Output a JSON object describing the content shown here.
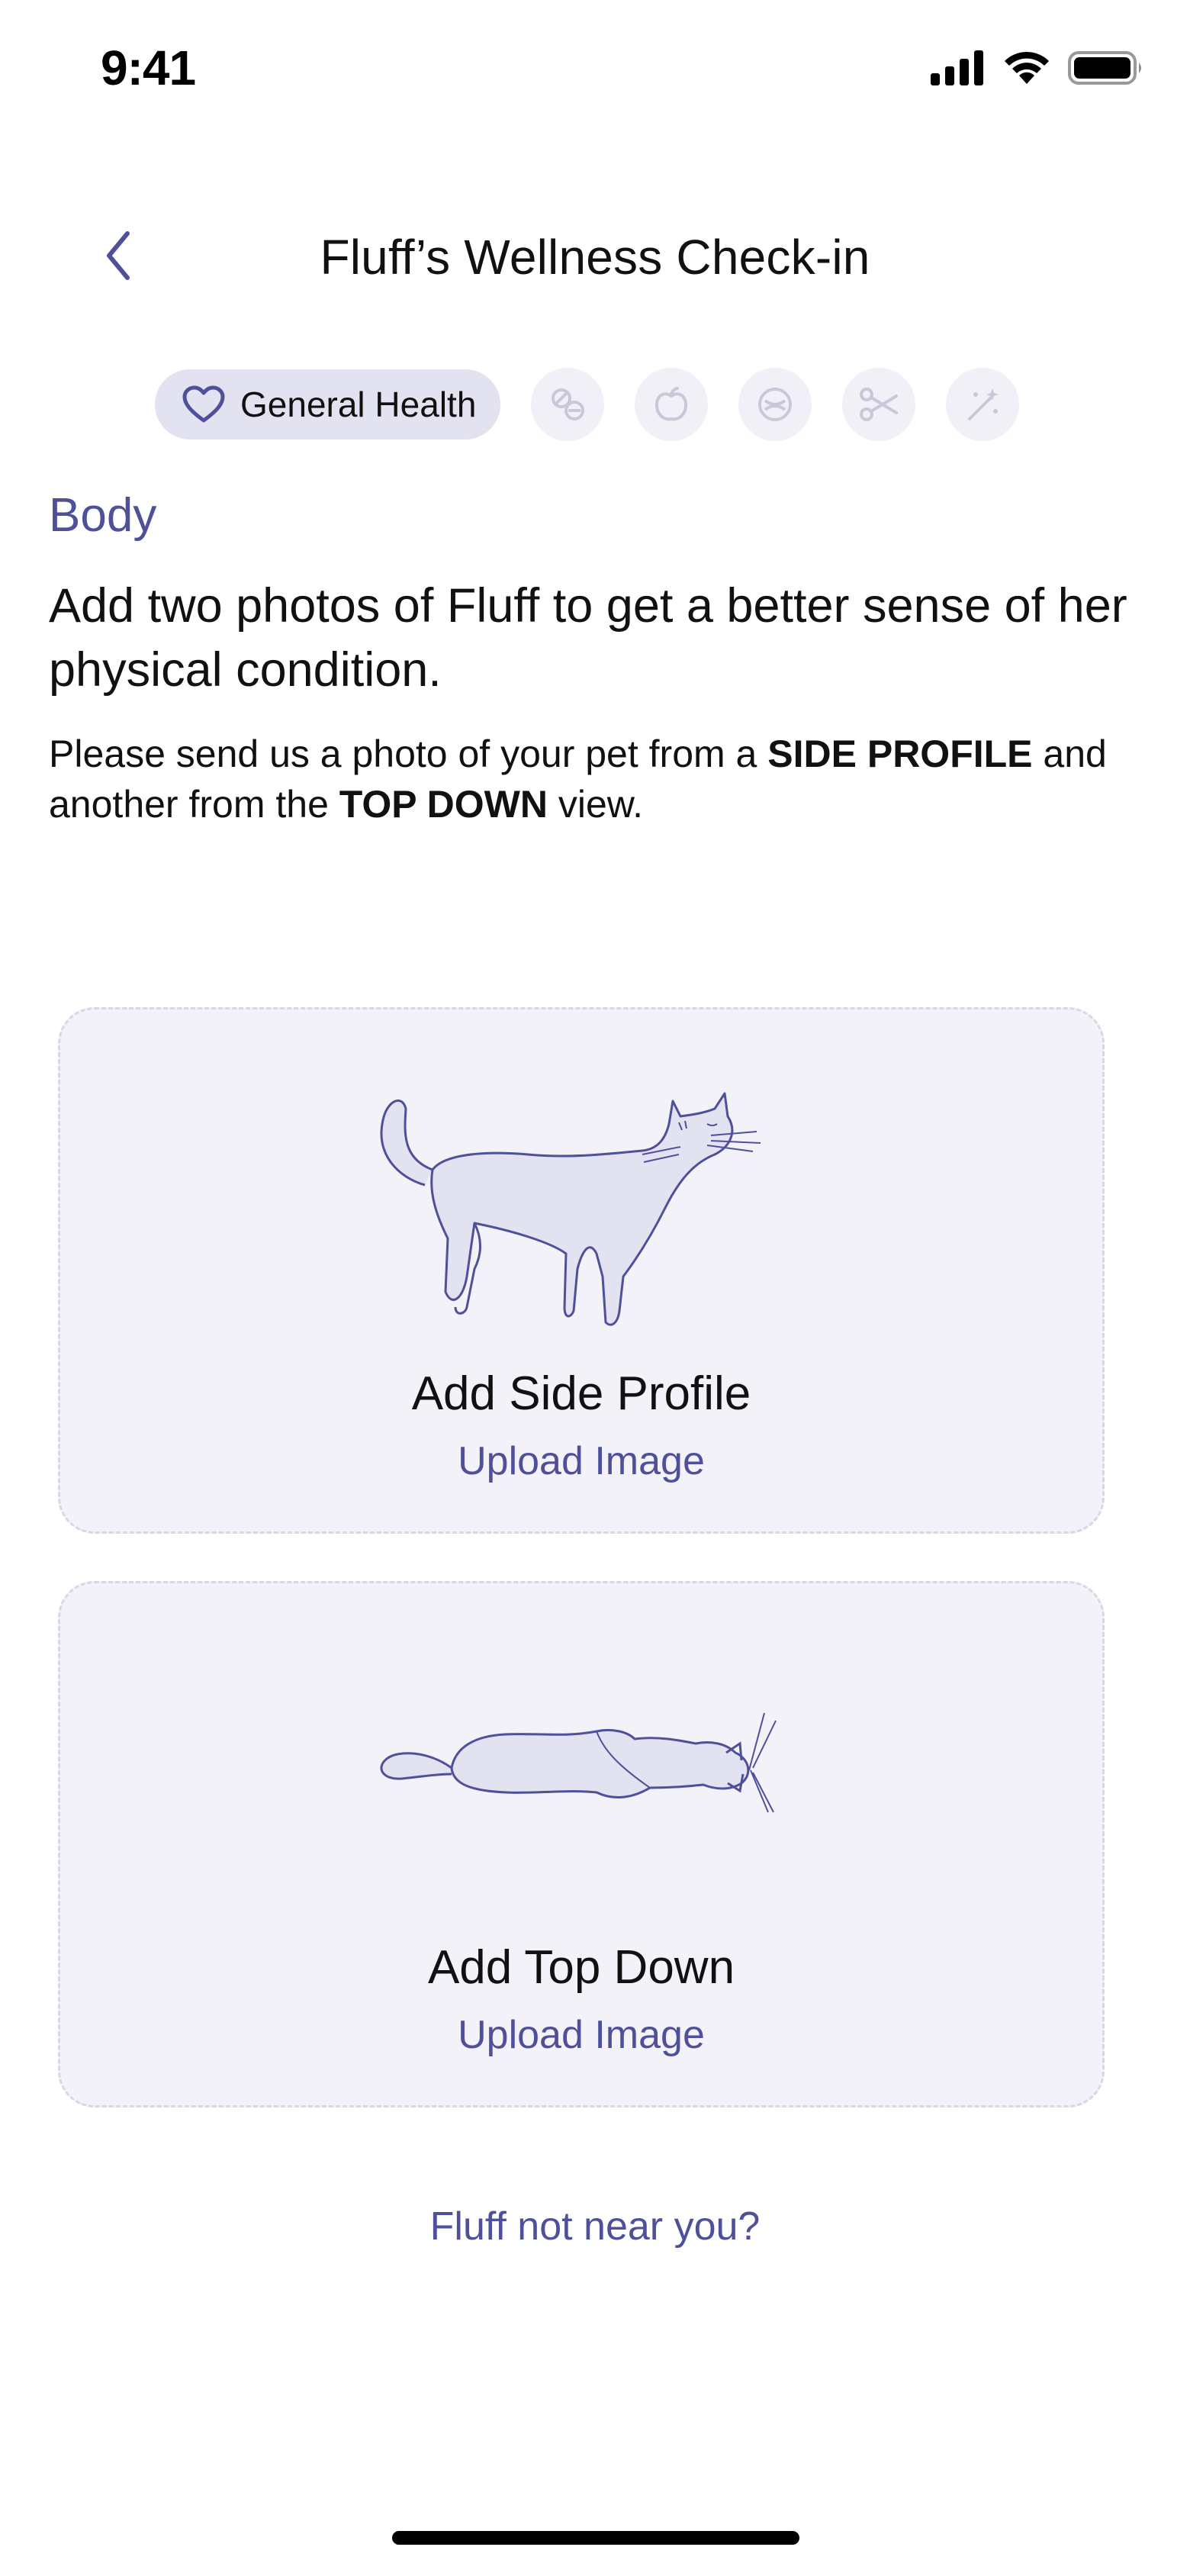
{
  "status_bar": {
    "time": "9:41"
  },
  "header": {
    "title": "Fluff’s Wellness Check-in",
    "back_icon": "chevron-left-icon"
  },
  "chips": {
    "active": {
      "label": "General Health",
      "icon": "heart-icon"
    },
    "others": [
      "pills-icon",
      "apple-icon",
      "bowl-icon",
      "scissors-icon",
      "wand-icon"
    ]
  },
  "content": {
    "section_label": "Body",
    "headline": "Add two photos of Fluff to get a better sense of her physical condition.",
    "body_part1": "Please send us a photo of your pet from a ",
    "body_bold1": "SIDE PROFILE",
    "body_part2": " and another from the ",
    "body_bold2": "TOP DOWN",
    "body_part3": " view."
  },
  "cards": {
    "side": {
      "title": "Add Side Profile",
      "link": "Upload Image",
      "icon": "cat-side-illustration"
    },
    "top": {
      "title": "Add Top Down",
      "link": "Upload Image",
      "icon": "cat-top-illustration"
    }
  },
  "footer": {
    "link": "Fluff not near you?"
  },
  "colors": {
    "accent": "#4f509a",
    "card_bg": "#f2f2f8",
    "chip_active_bg": "#e3e2f1",
    "chip_bg": "#f1f0f6",
    "illustration_fill": "#e3e2f1"
  }
}
